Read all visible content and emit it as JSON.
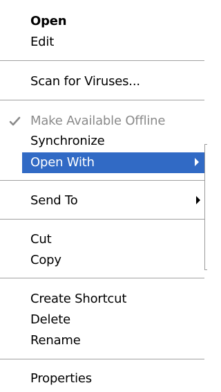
{
  "menu": {
    "open": "Open",
    "edit": "Edit",
    "scan": "Scan for Viruses...",
    "offline": "Make Available Offline",
    "sync": "Synchronize",
    "open_with": "Open With",
    "send_to": "Send To",
    "cut": "Cut",
    "copy": "Copy",
    "create_shortcut": "Create Shortcut",
    "delete": "Delete",
    "rename": "Rename",
    "properties": "Properties"
  },
  "states": {
    "offline_checked": true,
    "offline_disabled": true,
    "highlighted_item": "Open With"
  },
  "icons": {
    "check": "checkmark-icon",
    "submenu_arrow": "chevron-right-icon"
  },
  "colors": {
    "highlight": "#316ac5",
    "disabled_text": "#8a8a8a",
    "separator": "#a0a0a0"
  }
}
